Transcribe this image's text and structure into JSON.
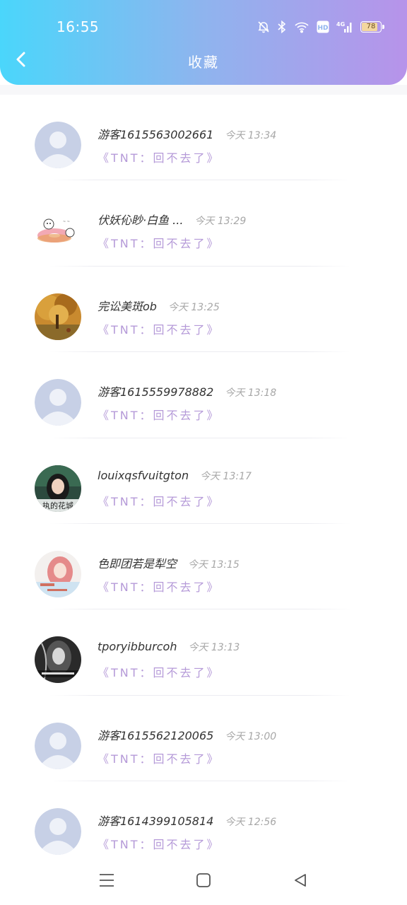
{
  "status_bar": {
    "time": "16:55",
    "battery_percent": "78",
    "icons": [
      "bell-off-icon",
      "bluetooth-icon",
      "wifi-icon",
      "hd-icon",
      "4g-signal-icon",
      "battery-icon"
    ]
  },
  "nav": {
    "title": "收藏",
    "back_icon": "chevron-left-icon"
  },
  "colors": {
    "gradient_start": "#4ad6fb",
    "gradient_end": "#b793ea",
    "subtitle": "#b59ad8",
    "name": "#333333",
    "time": "#a7a7a7"
  },
  "items": [
    {
      "name": "游客1615563002661",
      "time": "今天 13:34",
      "subtitle": "《TNT：回不去了》",
      "avatar": "default-avatar"
    },
    {
      "name": "伏妖伈眇·白鱼 ...",
      "time": "今天 13:29",
      "subtitle": "《TNT：回不去了》",
      "avatar": "donut-cartoon"
    },
    {
      "name": "完讼美斑ob",
      "time": "今天 13:25",
      "subtitle": "《TNT：回不去了》",
      "avatar": "autumn-tree-photo"
    },
    {
      "name": "游客1615559978882",
      "time": "今天 13:18",
      "subtitle": "《TNT：回不去了》",
      "avatar": "default-avatar"
    },
    {
      "name": "louixqsfvuitgton",
      "time": "今天 13:17",
      "subtitle": "《TNT：回不去了》",
      "avatar": "girl-photo",
      "avatar_caption": "执的花城"
    },
    {
      "name": "色即团若是犁空",
      "time": "今天 13:15",
      "subtitle": "《TNT：回不去了》",
      "avatar": "pink-hair-girl"
    },
    {
      "name": "tporyibburcoh",
      "time": "今天 13:13",
      "subtitle": "《TNT：回不去了》",
      "avatar": "bw-girl-photo"
    },
    {
      "name": "游客1615562120065",
      "time": "今天 13:00",
      "subtitle": "《TNT：回不去了》",
      "avatar": "default-avatar"
    },
    {
      "name": "游客1614399105814",
      "time": "今天 12:56",
      "subtitle": "《TNT：回不去了》",
      "avatar": "default-avatar"
    }
  ],
  "system_nav": [
    "menu-icon",
    "home-icon",
    "back-triangle-icon"
  ]
}
